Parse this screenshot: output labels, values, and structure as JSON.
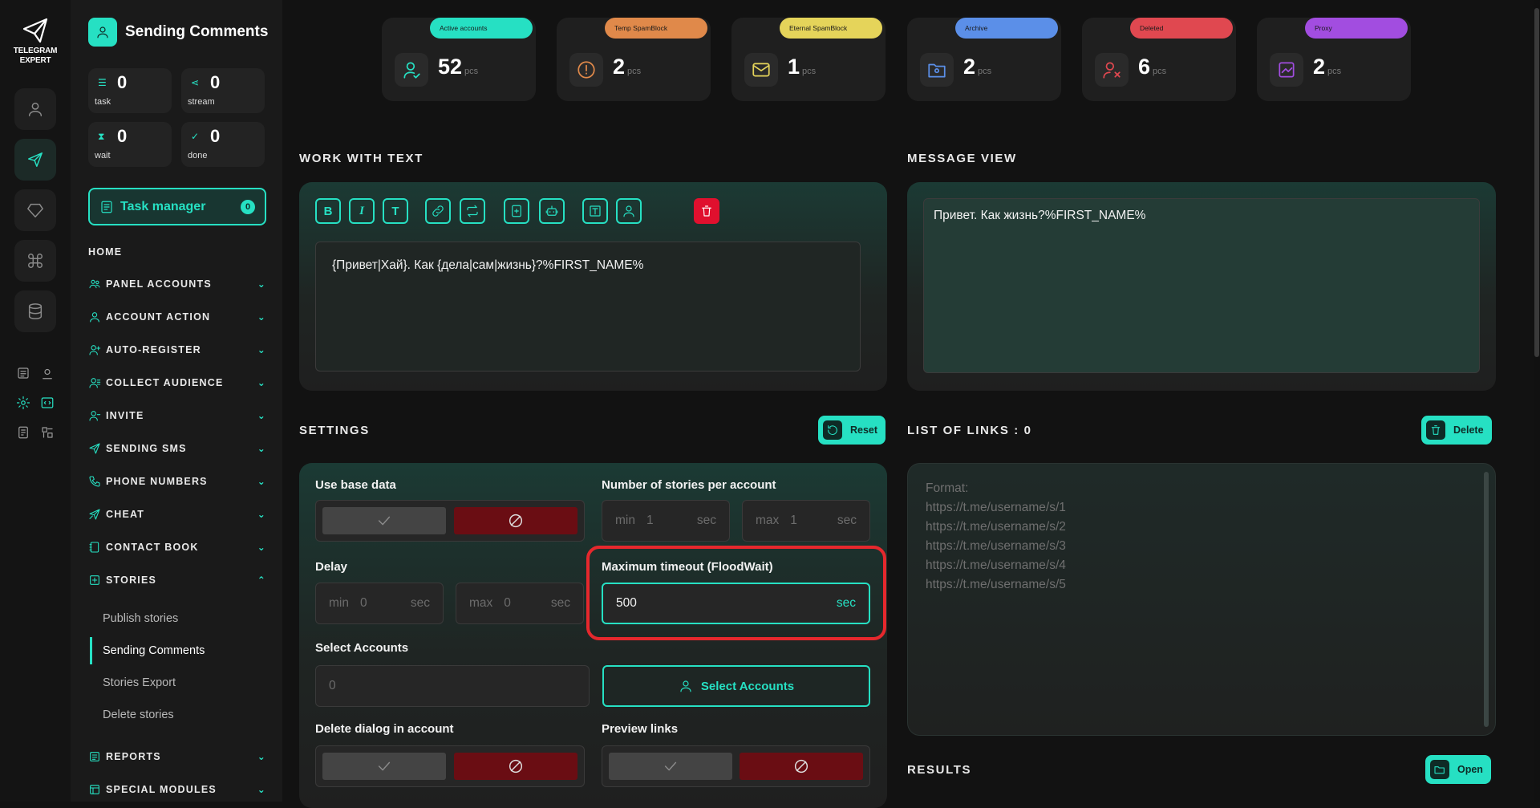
{
  "app": {
    "logo_text": "TELEGRAM\nEXPERT",
    "logo_line1": "TELEGRAM",
    "logo_line2": "EXPERT"
  },
  "sidebar": {
    "title": "Sending Comments",
    "stats": [
      {
        "value": "0",
        "label": "task"
      },
      {
        "value": "0",
        "label": "stream"
      },
      {
        "value": "0",
        "label": "wait"
      },
      {
        "value": "0",
        "label": "done"
      }
    ],
    "task_manager": {
      "label": "Task manager",
      "count": "0"
    },
    "home": "HOME",
    "nav": [
      "PANEL ACCOUNTS",
      "ACCOUNT ACTION",
      "AUTO-REGISTER",
      "COLLECT AUDIENCE",
      "INVITE",
      "SENDING SMS",
      "PHONE NUMBERS",
      "CHEAT",
      "CONTACT BOOK",
      "STORIES",
      "REPORTS",
      "SPECIAL MODULES"
    ],
    "stories_sub": [
      "Publish stories",
      "Sending Comments",
      "Stories Export",
      "Delete stories"
    ]
  },
  "counters": [
    {
      "label": "Active accounts",
      "value": "52",
      "unit": "pcs",
      "color": "#26e0c3"
    },
    {
      "label": "Temp SpamBlock",
      "value": "2",
      "unit": "pcs",
      "color": "#e0894a"
    },
    {
      "label": "Eternal SpamBlock",
      "value": "1",
      "unit": "pcs",
      "color": "#e5d45a"
    },
    {
      "label": "Archive",
      "value": "2",
      "unit": "pcs",
      "color": "#5b8fe8"
    },
    {
      "label": "Deleted",
      "value": "6",
      "unit": "pcs",
      "color": "#e04850"
    },
    {
      "label": "Proxy",
      "value": "2",
      "unit": "pcs",
      "color": "#a24de0"
    }
  ],
  "work_with_text": {
    "title": "WORK WITH TEXT",
    "toolbar": [
      "B",
      "I",
      "T"
    ],
    "text": "{Привет|Хай}. Как {дела|сам|жизнь}?%FIRST_NAME%"
  },
  "message_view": {
    "title": "MESSAGE VIEW",
    "text": "Привет. Как жизнь?%FIRST_NAME%"
  },
  "settings": {
    "title": "SETTINGS",
    "reset": "Reset",
    "use_base_data": "Use base data",
    "stories_per_account": "Number of stories per account",
    "stories_min": {
      "prefix": "min",
      "value": "1",
      "unit": "sec"
    },
    "stories_max": {
      "prefix": "max",
      "value": "1",
      "unit": "sec"
    },
    "delay": "Delay",
    "delay_min": {
      "prefix": "min",
      "value": "0",
      "unit": "sec"
    },
    "delay_max": {
      "prefix": "max",
      "value": "0",
      "unit": "sec"
    },
    "max_timeout": "Maximum timeout (FloodWait)",
    "max_timeout_value": "500",
    "max_timeout_unit": "sec",
    "select_accounts": "Select Accounts",
    "select_accounts_value": "0",
    "select_accounts_button": "Select Accounts",
    "delete_dialog": "Delete dialog in account",
    "preview_links": "Preview links"
  },
  "links": {
    "title": "LIST OF LINKS : 0",
    "delete": "Delete",
    "placeholder": [
      "Format:",
      "https://t.me/username/s/1",
      "https://t.me/username/s/2",
      "https://t.me/username/s/3",
      "https://t.me/username/s/4",
      "https://t.me/username/s/5"
    ]
  },
  "results": {
    "title": "RESULTS",
    "open": "Open"
  }
}
